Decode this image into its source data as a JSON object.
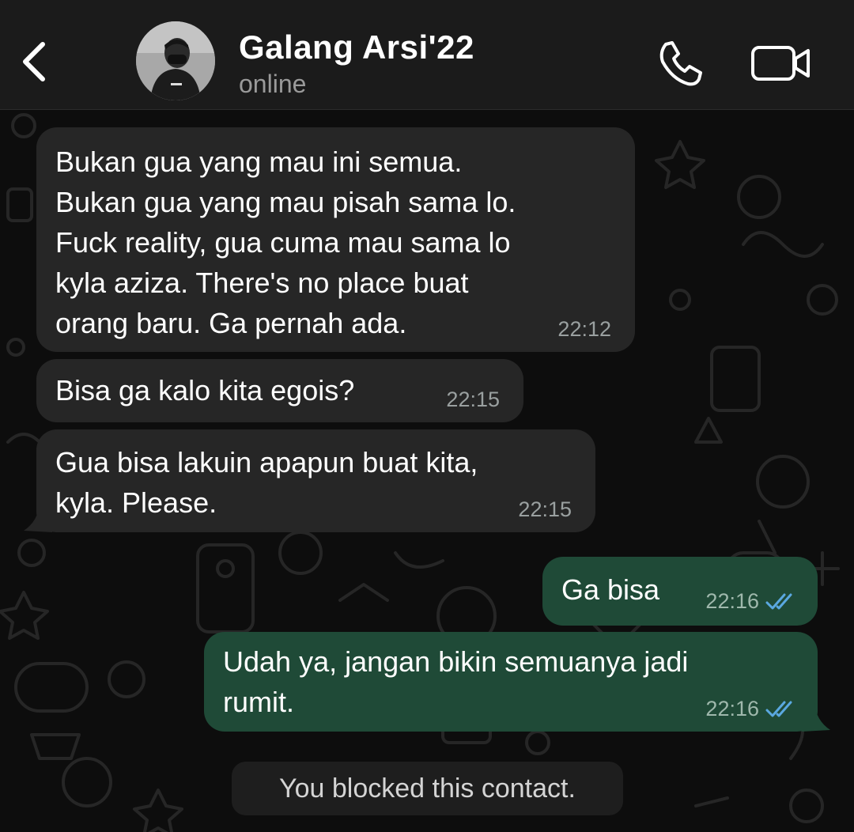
{
  "header": {
    "back_icon": "chevron-left-icon",
    "contact_name": "Galang Arsi'22",
    "status": "online",
    "call_icon": "phone-icon",
    "video_icon": "video-camera-icon"
  },
  "messages": [
    {
      "direction": "incoming",
      "text": "Bukan gua yang mau ini semua.\nBukan gua yang mau pisah sama lo.\nFuck reality, gua cuma mau sama lo\nkyla aziza. There's no place buat\norang baru. Ga pernah ada.",
      "time": "22:12"
    },
    {
      "direction": "incoming",
      "text": "Bisa ga kalo kita egois?",
      "time": "22:15"
    },
    {
      "direction": "incoming",
      "text": "Gua bisa lakuin apapun buat kita,\nkyla. Please.",
      "time": "22:15"
    },
    {
      "direction": "outgoing",
      "text": "Ga bisa",
      "time": "22:16",
      "status": "read"
    },
    {
      "direction": "outgoing",
      "text": "Udah ya, jangan bikin semuanya jadi\nrumit.",
      "time": "22:16",
      "status": "read"
    }
  ],
  "system_notice": "You blocked this contact.",
  "colors": {
    "header_bg": "#1b1b1b",
    "chat_bg": "#0d0d0d",
    "incoming_bubble": "#262626",
    "outgoing_bubble": "#1f4a37",
    "read_ticks": "#5aa8e0",
    "secondary_text": "#9a9a9a"
  }
}
